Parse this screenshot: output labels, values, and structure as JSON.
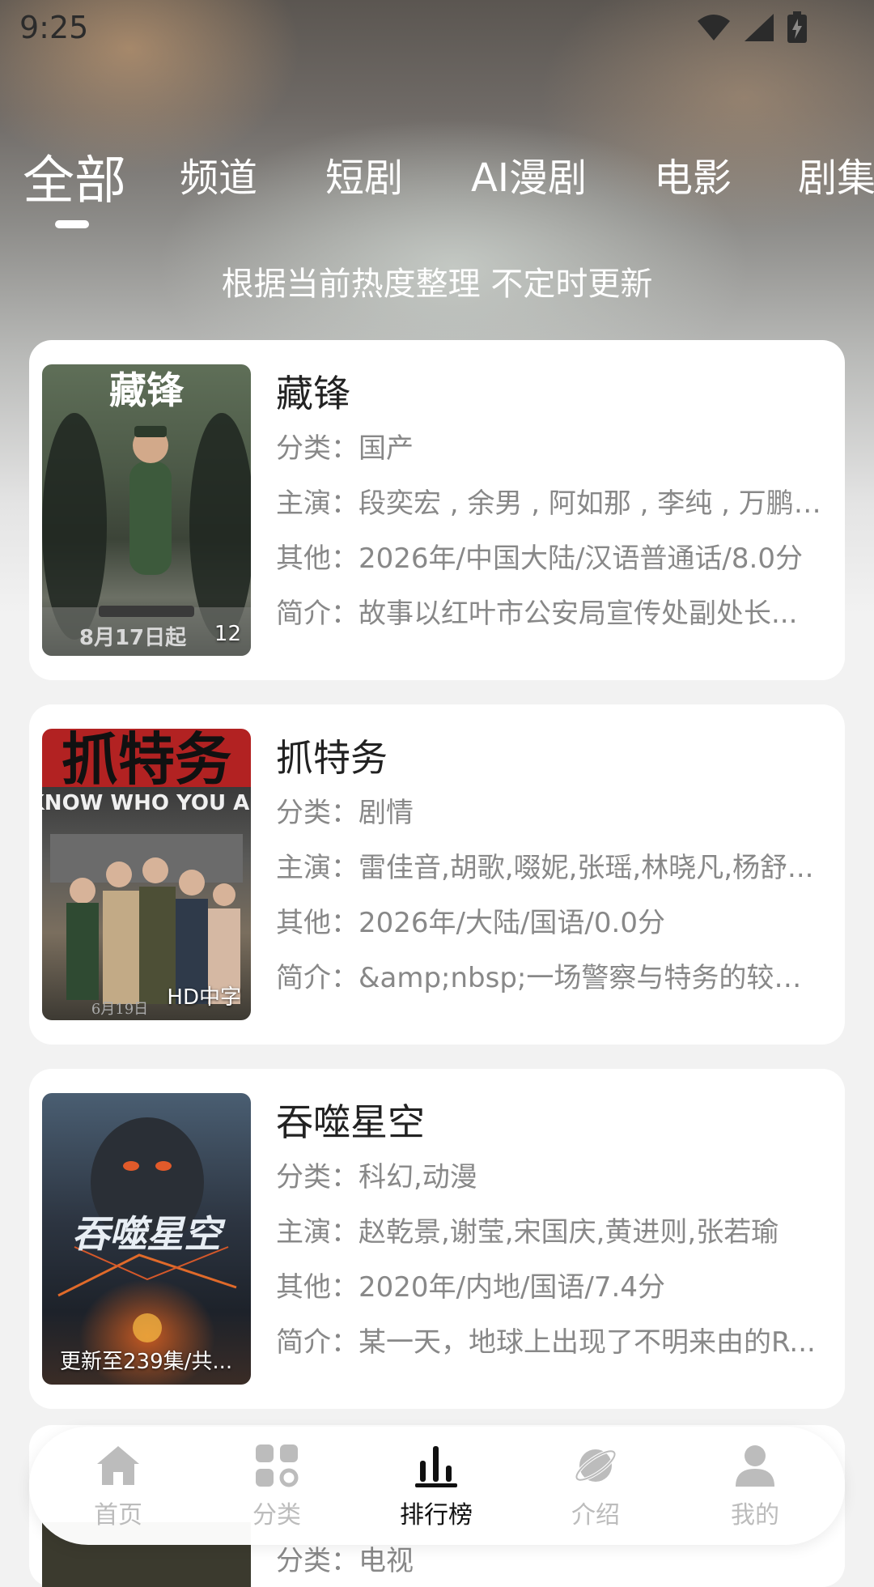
{
  "status_bar": {
    "time": "9:25"
  },
  "tabs": [
    {
      "label": "全部",
      "active": true
    },
    {
      "label": "频道",
      "active": false
    },
    {
      "label": "短剧",
      "active": false
    },
    {
      "label": "AI漫剧",
      "active": false
    },
    {
      "label": "电影",
      "active": false
    },
    {
      "label": "剧集",
      "active": false
    }
  ],
  "subtitle": "根据当前热度整理 不定时更新",
  "labels": {
    "category": "分类：",
    "cast": "主演：",
    "other": "其他：",
    "intro": "简介："
  },
  "items": [
    {
      "title": "藏锋",
      "category": "国产",
      "cast": "段奕宏 , 余男 , 阿如那 , 李纯 , 万鹏 ,...",
      "other": "2026年/中国大陆/汉语普通话/8.0分",
      "intro": "故事以红叶市公安局宣传处副处长...",
      "badge": "12",
      "poster_title": "藏锋",
      "poster_footer": "8月17日起"
    },
    {
      "title": "抓特务",
      "category": "剧情",
      "cast": "雷佳音,胡歌,啜妮,张瑶,林晓凡,杨舒...",
      "other": "2026年/大陆/国语/0.0分",
      "intro": "&amp;nbsp;一场警察与特务的较量...",
      "badge": "HD中字",
      "poster_title": "抓特务",
      "poster_subtitle": "I KNOW WHO YOU ARE",
      "poster_footer": "6月19日"
    },
    {
      "title": "吞噬星空",
      "category": "科幻,动漫",
      "cast": "赵乾景,谢莹,宋国庆,黄进则,张若瑜",
      "other": "2020年/内地/国语/7.4分",
      "intro": "某一天，地球上出现了不明来由的R...",
      "badge": "更新至239集/共...",
      "poster_title": "吞噬星空"
    }
  ],
  "peek_text": "分类：电视",
  "bottom_nav": [
    {
      "label": "首页",
      "icon": "home-icon",
      "active": false
    },
    {
      "label": "分类",
      "icon": "grid-icon",
      "active": false
    },
    {
      "label": "排行榜",
      "icon": "chart-icon",
      "active": true
    },
    {
      "label": "介绍",
      "icon": "planet-icon",
      "active": false
    },
    {
      "label": "我的",
      "icon": "user-icon",
      "active": false
    }
  ],
  "colors": {
    "active_nav": "#111111",
    "inactive_nav": "#bcbcbc",
    "card_bg": "#ffffff"
  }
}
